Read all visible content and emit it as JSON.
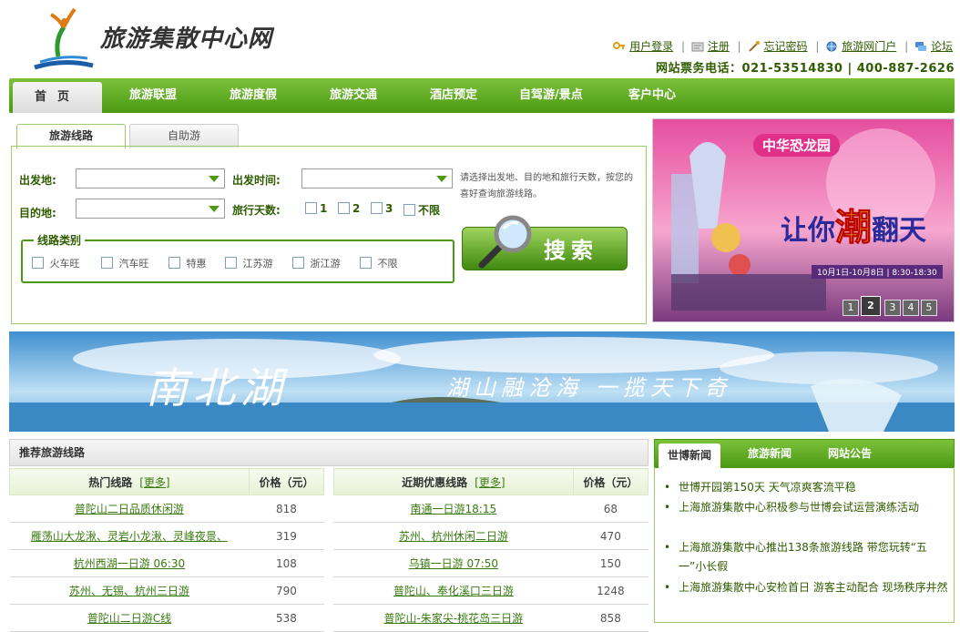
{
  "header": {
    "site_name": "旅游集散中心网",
    "links": [
      "用户登录",
      "注册",
      "忘记密码",
      "旅游网门户",
      "论坛"
    ],
    "hotline": "网站票务电话：021-53514830 | 400-887-2626"
  },
  "nav": {
    "home": "首页",
    "items": [
      "旅游联盟",
      "旅游度假",
      "旅游交通",
      "酒店预定",
      "自驾游/景点",
      "客户中心"
    ]
  },
  "search": {
    "tabs": [
      "旅游线路",
      "自助游"
    ],
    "depart_label": "出发地:",
    "depart_time_label": "出发时间:",
    "dest_label": "目的地:",
    "days_label": "旅行天数:",
    "days_options": [
      "1",
      "2",
      "3",
      "不限"
    ],
    "tip": "请选择出发地、目的地和旅行天数，按您的喜好查询旅游线路。",
    "route_type_legend": "线路类别",
    "route_types": [
      "火车旺",
      "汽车旺",
      "特惠",
      "江苏游",
      "浙江游",
      "不限"
    ],
    "button": "搜索"
  },
  "promo": {
    "badge": "中华恐龙园",
    "slogan_a": "让你",
    "slogan_b": "潮",
    "slogan_c": "翻天",
    "dates": "10月1日-10月8日 | 8:30-18:30",
    "pages": [
      "1",
      "2",
      "3",
      "4",
      "5"
    ],
    "active_page": "2"
  },
  "lake_banner": {
    "title": "南北湖",
    "slogan": "湖山融沧海 一揽天下奇"
  },
  "recommend": {
    "heading": "推荐旅游线路",
    "col_hot": "热门线路",
    "col_recent": "近期优惠线路",
    "more": "[更多]",
    "col_price": "价格（元）",
    "rows": [
      {
        "hot": "普陀山二日品质休闲游",
        "hot_price": "818",
        "recent": "南通一日游18:15",
        "recent_price": "68"
      },
      {
        "hot": "雁荡山大龙湫、灵岩小龙湫、灵峰夜景、",
        "hot_price": "319",
        "recent": "苏州、杭州休闲二日游",
        "recent_price": "470"
      },
      {
        "hot": "杭州西湖一日游 06:30",
        "hot_price": "108",
        "recent": "乌镇一日游 07:50",
        "recent_price": "150"
      },
      {
        "hot": "苏州、无锡、杭州三日游",
        "hot_price": "790",
        "recent": "普陀山、奉化溪口三日游",
        "recent_price": "1248"
      },
      {
        "hot": "普陀山二日游C线",
        "hot_price": "538",
        "recent": "普陀山-朱家尖-桃花岛三日游",
        "recent_price": "858"
      }
    ]
  },
  "news": {
    "tabs": [
      "世博新闻",
      "旅游新闻",
      "网站公告"
    ],
    "items": [
      "世博开园第150天 天气凉爽客流平稳",
      "上海旅游集散中心积极参与世博会试运营演练活动",
      "上海旅游集散中心推出138条旅游线路 带您玩转“五一”小长假",
      "上海旅游集散中心安检首日 游客主动配合 现场秩序井然"
    ]
  },
  "colors": {
    "brand_green": "#4c9a14",
    "link_green": "#2f5c00",
    "accent_orange": "#e0901a"
  }
}
